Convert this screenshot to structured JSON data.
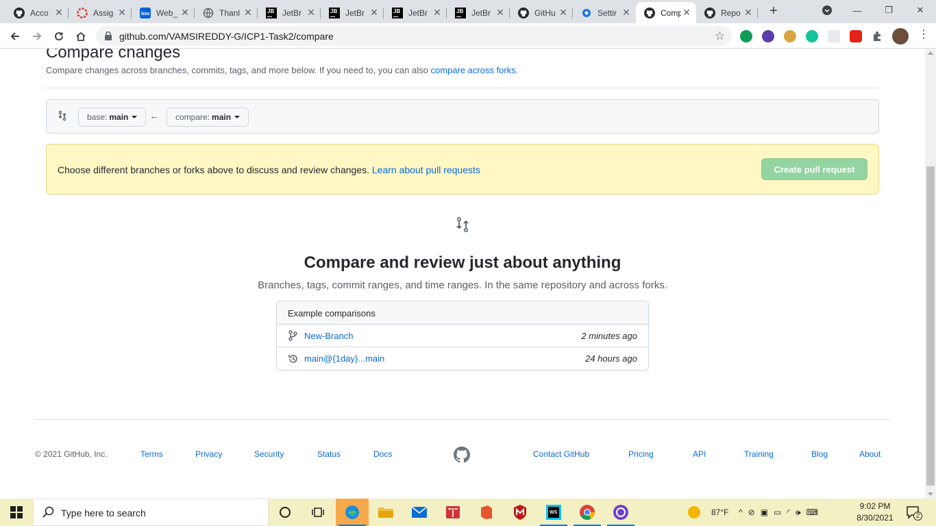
{
  "browser": {
    "tabs": [
      {
        "title": "Acco",
        "icon": "github-icon"
      },
      {
        "title": "Assig",
        "icon": "assignment-icon"
      },
      {
        "title": "Web_",
        "icon": "box-icon"
      },
      {
        "title": "Thanl",
        "icon": "globe-icon"
      },
      {
        "title": "JetBr",
        "icon": "jetbrains-icon"
      },
      {
        "title": "JetBr",
        "icon": "jetbrains-icon"
      },
      {
        "title": "JetBr",
        "icon": "jetbrains-icon"
      },
      {
        "title": "JetBr",
        "icon": "jetbrains-icon"
      },
      {
        "title": "GitHu",
        "icon": "github-icon"
      },
      {
        "title": "Settir",
        "icon": "gear-icon"
      },
      {
        "title": "Comp",
        "icon": "github-icon",
        "active": true
      },
      {
        "title": "Repo",
        "icon": "github-icon"
      }
    ],
    "url": "github.com/VAMSIREDDY-G/ICP1-Task2/compare"
  },
  "page": {
    "title": "Compare changes",
    "subtitle": "Compare changes across branches, commits, tags, and more below. If you need to, you can also",
    "subtitle_link": "compare across forks",
    "subtitle_end": ".",
    "base_label": "base:",
    "base_value": "main",
    "compare_label": "compare:",
    "compare_value": "main",
    "flash_text": "Choose different branches or forks above to discuss and review changes.",
    "flash_link": "Learn about pull requests",
    "create_pr_label": "Create pull request",
    "blank_title": "Compare and review just about anything",
    "blank_subtitle": "Branches, tags, commit ranges, and time ranges. In the same repository and across forks.",
    "examples_header": "Example comparisons",
    "examples": [
      {
        "label": "New-Branch",
        "time": "2 minutes ago",
        "icon": "branch-icon"
      },
      {
        "label": "main@{1day}...main",
        "time": "24 hours ago",
        "icon": "history-icon"
      }
    ]
  },
  "footer": {
    "copyright": "© 2021 GitHub, Inc.",
    "links_left": [
      "Terms",
      "Privacy",
      "Security",
      "Status",
      "Docs"
    ],
    "links_right": [
      "Contact GitHub",
      "Pricing",
      "API",
      "Training",
      "Blog",
      "About"
    ]
  },
  "taskbar": {
    "search_placeholder": "Type here to search",
    "weather": "87°F",
    "time": "9:02 PM",
    "date": "8/30/2021",
    "notifications": "2"
  }
}
